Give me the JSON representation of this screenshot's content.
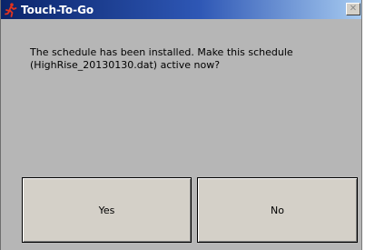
{
  "window": {
    "title": "Touch-To-Go",
    "close_glyph": "✕"
  },
  "message": {
    "line1": "The schedule has been installed.  Make this schedule",
    "line2": "(HighRise_20130130.dat) active now?"
  },
  "buttons": {
    "yes_label": "Yes",
    "no_label": "No"
  },
  "icons": {
    "app": "running-figure-icon",
    "close": "close-icon"
  },
  "colors": {
    "title_start": "#0a246a",
    "title_end": "#a6caf0",
    "dialog_bg": "#b6b6b6",
    "button_bg": "#d4d0c8",
    "app_icon": "#e0331f"
  }
}
